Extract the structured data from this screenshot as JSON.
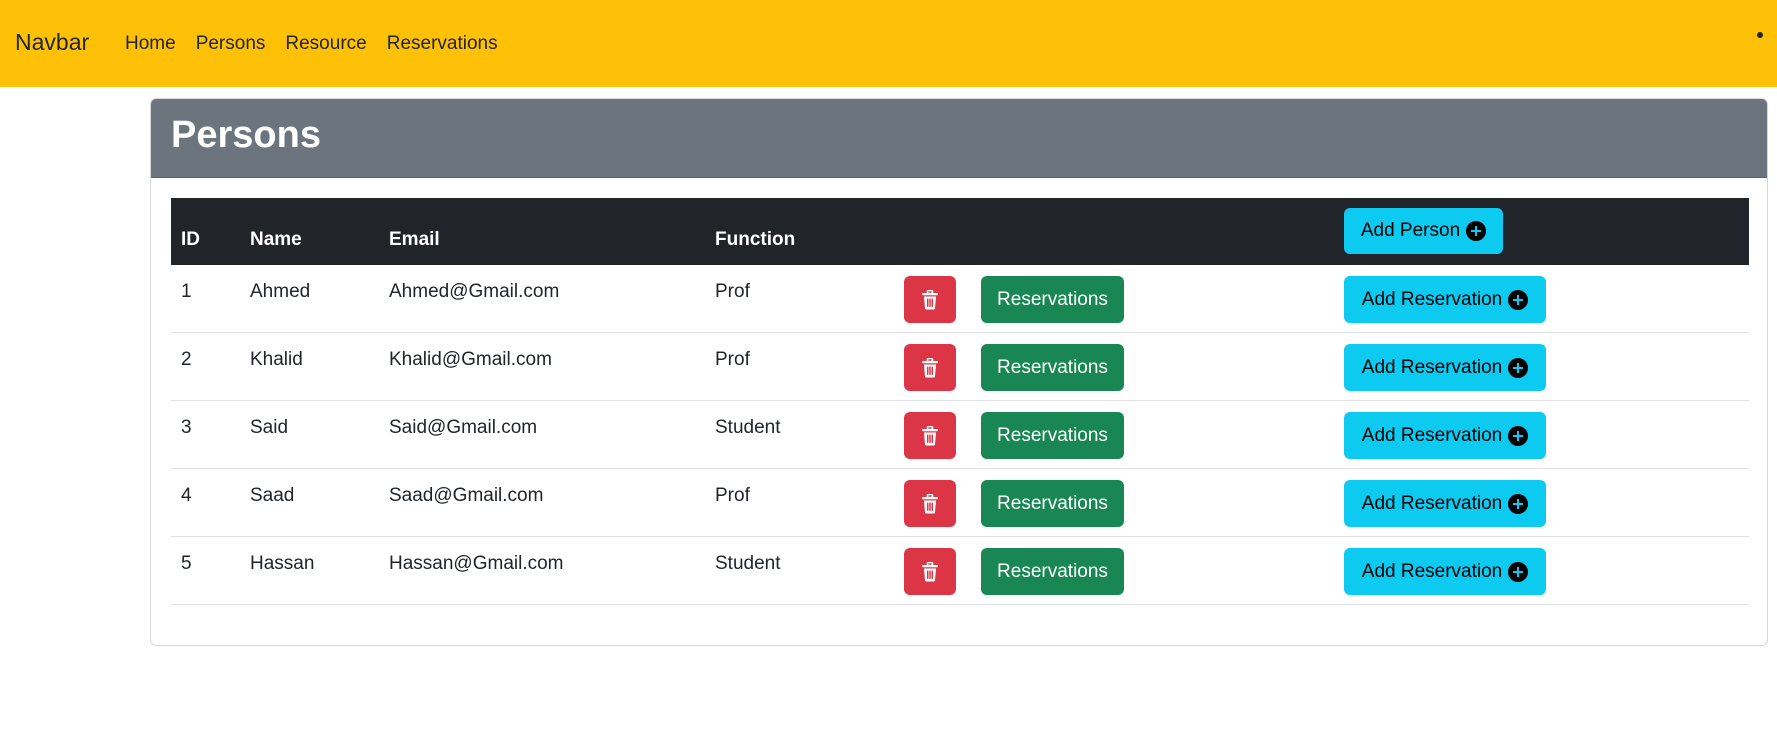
{
  "navbar": {
    "brand": "Navbar",
    "links": [
      "Home",
      "Persons",
      "Resource",
      "Reservations"
    ],
    "bg_color": "#ffc107"
  },
  "card": {
    "title": "Persons",
    "header_color": "#6c757d"
  },
  "table": {
    "headers": {
      "id": "ID",
      "name": "Name",
      "email": "Email",
      "function": "Function"
    },
    "add_person_label": "Add Person",
    "rows": [
      {
        "id": "1",
        "name": "Ahmed",
        "email": "Ahmed@Gmail.com",
        "function": "Prof"
      },
      {
        "id": "2",
        "name": "Khalid",
        "email": "Khalid@Gmail.com",
        "function": "Prof"
      },
      {
        "id": "3",
        "name": "Said",
        "email": "Said@Gmail.com",
        "function": "Student"
      },
      {
        "id": "4",
        "name": "Saad",
        "email": "Saad@Gmail.com",
        "function": "Prof"
      },
      {
        "id": "5",
        "name": "Hassan",
        "email": "Hassan@Gmail.com",
        "function": "Student"
      }
    ],
    "reservations_label": "Reservations",
    "add_reservation_label": "Add Reservation",
    "icons": {
      "delete": "trash-icon",
      "add": "plus-circle-icon"
    },
    "colors": {
      "danger": "#dc3545",
      "success": "#198754",
      "info": "#0dcaf0",
      "header": "#212529"
    }
  }
}
